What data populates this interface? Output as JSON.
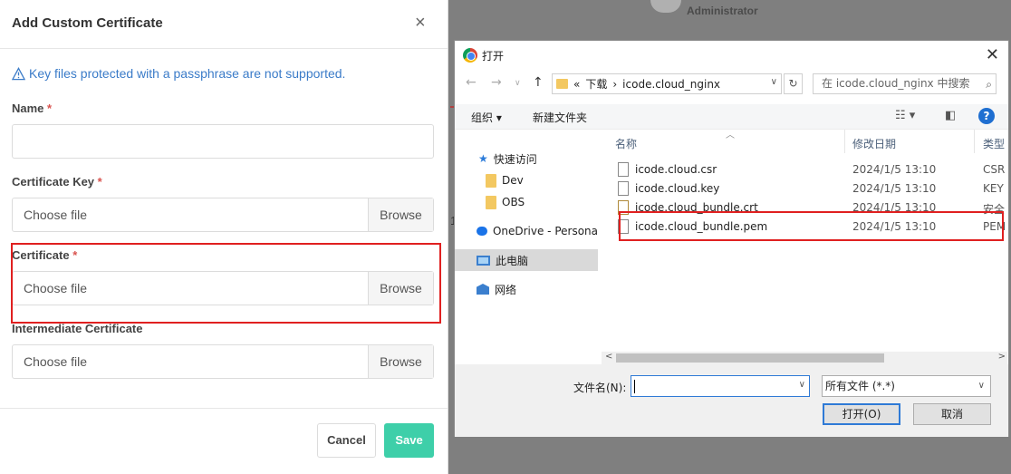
{
  "background": {
    "user_label": "Administrator",
    "partial_digit": "1"
  },
  "modal": {
    "title": "Add Custom Certificate",
    "close": "×",
    "alert": "Key files protected with a passphrase are not supported.",
    "required_mark": "*",
    "fields": [
      {
        "label": "Name",
        "required": true
      },
      {
        "label": "Certificate Key",
        "required": true,
        "placeholder": "Choose file",
        "browse": "Browse"
      },
      {
        "label": "Certificate",
        "required": true,
        "placeholder": "Choose file",
        "browse": "Browse"
      },
      {
        "label": "Intermediate Certificate",
        "required": false,
        "placeholder": "Choose file",
        "browse": "Browse"
      }
    ],
    "cancel": "Cancel",
    "save": "Save",
    "colors": {
      "accent": "#3ecfa9",
      "info": "#3a7bc8",
      "required": "#d9534f",
      "highlight": "#e02020"
    }
  },
  "dialog": {
    "title": "打开",
    "address": {
      "prefix": "«",
      "crumbs": [
        "下载",
        "icode.cloud_nginx"
      ],
      "sep": "›"
    },
    "search_placeholder": "在 icode.cloud_nginx 中搜索",
    "toolbar": {
      "organize": "组织",
      "new_folder": "新建文件夹",
      "help": "?"
    },
    "nav": [
      {
        "label": "快速访问",
        "icon": "star-icon"
      },
      {
        "label": "Dev",
        "icon": "folder-icon"
      },
      {
        "label": "OBS",
        "icon": "folder-icon"
      },
      {
        "label": "OneDrive - Persona",
        "icon": "cloud-icon"
      },
      {
        "label": "此电脑",
        "icon": "pc-icon",
        "selected": true
      },
      {
        "label": "网络",
        "icon": "network-icon"
      }
    ],
    "columns": {
      "name": "名称",
      "date": "修改日期",
      "type": "类型"
    },
    "files": [
      {
        "name": "icode.cloud.csr",
        "date": "2024/1/5 13:10",
        "type": "CSR"
      },
      {
        "name": "icode.cloud.key",
        "date": "2024/1/5 13:10",
        "type": "KEY"
      },
      {
        "name": "icode.cloud_bundle.crt",
        "date": "2024/1/5 13:10",
        "type": "安全"
      },
      {
        "name": "icode.cloud_bundle.pem",
        "date": "2024/1/5 13:10",
        "type": "PEM"
      }
    ],
    "filename_label": "文件名(N):",
    "filename_value": "",
    "filetype": "所有文件 (*.*)",
    "open": "打开(O)",
    "cancel": "取消"
  }
}
